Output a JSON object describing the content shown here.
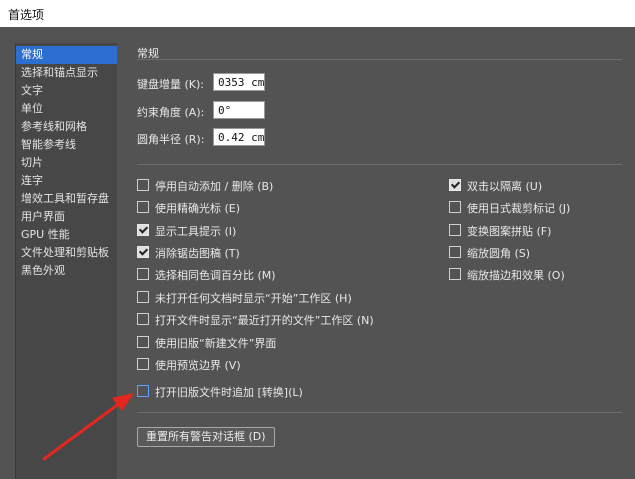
{
  "window": {
    "title": "首选项"
  },
  "sidebar": {
    "items": [
      {
        "label": "常规",
        "selected": true
      },
      {
        "label": "选择和锚点显示"
      },
      {
        "label": "文字"
      },
      {
        "label": "单位"
      },
      {
        "label": "参考线和网格"
      },
      {
        "label": "智能参考线"
      },
      {
        "label": "切片"
      },
      {
        "label": "连字"
      },
      {
        "label": "增效工具和暂存盘"
      },
      {
        "label": "用户界面"
      },
      {
        "label": "GPU 性能"
      },
      {
        "label": "文件处理和剪贴板"
      },
      {
        "label": "黑色外观"
      }
    ]
  },
  "main": {
    "section_title": "常规",
    "fields": {
      "keyboard_increment": {
        "label": "键盘增量 (K):",
        "value": "0353 cm"
      },
      "constrain_angle": {
        "label": "约束角度 (A):",
        "value": "0°"
      },
      "corner_radius": {
        "label": "圆角半径 (R):",
        "value": "0.42 cm"
      }
    },
    "left_options": [
      {
        "label": "停用自动添加 / 删除 (B)",
        "checked": false
      },
      {
        "label": "使用精确光标 (E)",
        "checked": false
      },
      {
        "label": "显示工具提示 (I)",
        "checked": true
      },
      {
        "label": "消除锯齿图稿 (T)",
        "checked": true
      },
      {
        "label": "选择相同色调百分比 (M)",
        "checked": false
      },
      {
        "label": "未打开任何文档时显示“开始”工作区 (H)",
        "checked": false
      },
      {
        "label": "打开文件时显示“最近打开的文件”工作区 (N)",
        "checked": false
      },
      {
        "label": "使用旧版“新建文件”界面",
        "checked": false
      },
      {
        "label": "使用预览边界 (V)",
        "checked": false
      },
      {
        "label": "打开旧版文件时追加 [转换](L)",
        "checked": false
      }
    ],
    "right_options": [
      {
        "label": "双击以隔离 (U)",
        "checked": true
      },
      {
        "label": "使用日式裁剪标记 (J)",
        "checked": false
      },
      {
        "label": "变换图案拼贴 (F)",
        "checked": false
      },
      {
        "label": "缩放圆角 (S)",
        "checked": false
      },
      {
        "label": "缩放描边和效果 (O)",
        "checked": false
      }
    ],
    "reset_button": "重置所有警告对话框 (D)"
  },
  "colors": {
    "background": "#535353",
    "sidebar_bg": "#474747",
    "selection": "#2d6fd1",
    "annotation_arrow": "#e5261f"
  }
}
